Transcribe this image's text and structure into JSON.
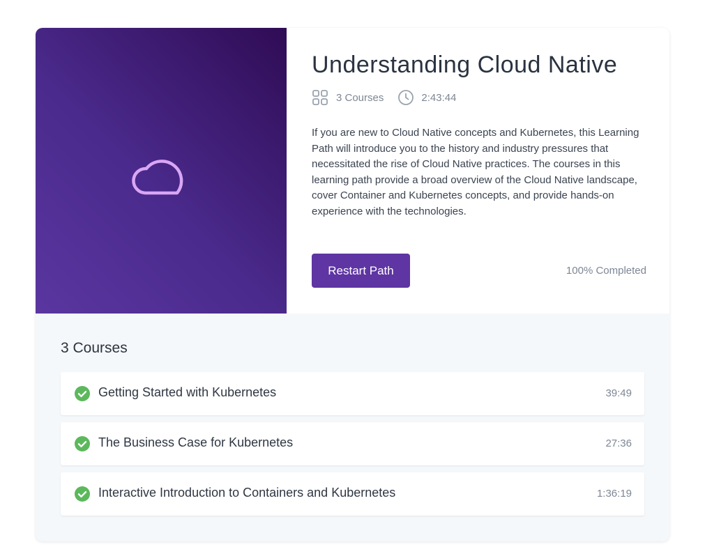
{
  "path": {
    "title": "Understanding Cloud Native",
    "courses_count": "3 Courses",
    "duration": "2:43:44",
    "description": "If you are new to Cloud Native concepts and Kubernetes, this Learning Path will introduce you to the history and industry pressures that necessitated the rise of Cloud Native practices. The courses in this learning path provide a broad overview of the Cloud Native landscape, cover Container and Kubernetes concepts, and provide hands-on experience with the technologies.",
    "restart_label": "Restart Path",
    "progress_label": "100% Completed",
    "progress_value": 1.0,
    "hero_icon": "cloud-icon"
  },
  "courses": {
    "heading": "3 Courses",
    "items": [
      {
        "title": "Getting Started with Kubernetes",
        "duration": "39:49",
        "status": "completed"
      },
      {
        "title": "The Business Case for Kubernetes",
        "duration": "27:36",
        "status": "completed"
      },
      {
        "title": "Interactive Introduction to Containers and Kubernetes",
        "duration": "1:36:19",
        "status": "completed"
      }
    ]
  },
  "colors": {
    "accent": "#5e35a2",
    "hero_gradient_start": "#5a36a0",
    "hero_gradient_end": "#300c55",
    "cloud_outline": "#d9a6f5",
    "complete_green": "#5cb85c"
  }
}
